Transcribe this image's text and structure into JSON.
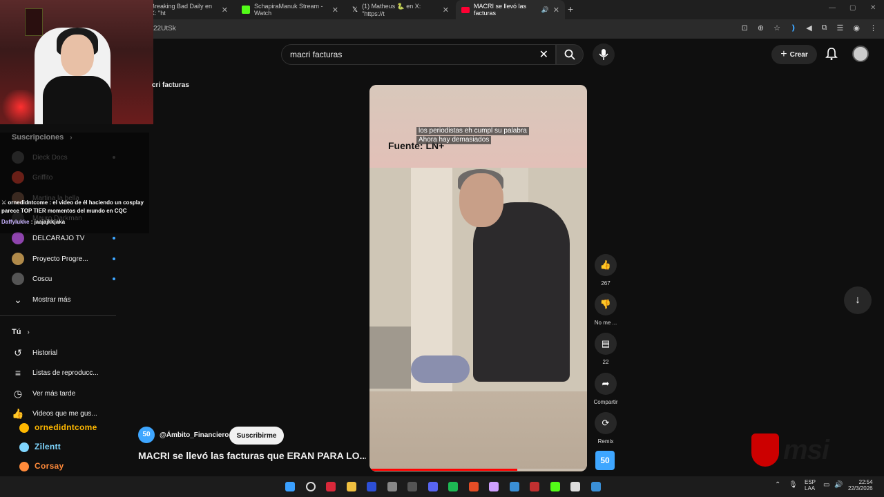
{
  "browser": {
    "tabs": [
      {
        "title": "Breaking Bad Daily en X: \"ht",
        "color": "#222222"
      },
      {
        "title": "SchapiraManuk Stream - Watch",
        "color": "#53fc18"
      },
      {
        "title": "(1) Matheus 🐍 en X: \"https://t",
        "color": "#000000"
      },
      {
        "title": "MACRI se llevó las facturas",
        "color": "#ff0033"
      }
    ],
    "url_fragment": "22UtSk"
  },
  "header": {
    "search_value": "macri facturas",
    "create_label": "Crear"
  },
  "page": {
    "partial_title": "cri facturas"
  },
  "sidebar": {
    "subscriptions_label": "Suscripciones",
    "subscriptions": [
      {
        "name": "Dieck Docs",
        "color": "#444444",
        "dim": true
      },
      {
        "name": "Griffito",
        "color": "#c0392b",
        "dim": true
      },
      {
        "name": "Martina la bella",
        "color": "#6b4c3b",
        "dim": true
      },
      {
        "name": "Mauro Darkman",
        "color": "#333333",
        "dim": true
      },
      {
        "name": "DELCARAJO TV",
        "color": "#8e44ad",
        "dim": false
      },
      {
        "name": "Proyecto Progre...",
        "color": "#b08a4a",
        "dim": false
      },
      {
        "name": "Coscu",
        "color": "#555555",
        "dim": false
      }
    ],
    "show_more": "Mostrar más",
    "you_label": "Tú",
    "you_items": [
      {
        "label": "Historial",
        "icon": "history-icon",
        "glyph": "↺"
      },
      {
        "label": "Listas de reproducc...",
        "icon": "playlist-icon",
        "glyph": "≡"
      },
      {
        "label": "Ver más tarde",
        "icon": "clock-icon",
        "glyph": "◷"
      },
      {
        "label": "Videos que me gus...",
        "icon": "thumb-up-icon",
        "glyph": "👍"
      }
    ]
  },
  "chat": [
    {
      "user": "ornedidntcome",
      "text": " : el video de él haciendo un cosplay parece TOP TIER momentos del mundo en CQC"
    },
    {
      "user": "Daffylukke",
      "text": " : jaajajkkjaka"
    }
  ],
  "alerts": [
    {
      "name": "ornedidntcome",
      "color": "#ffb800"
    },
    {
      "name": "Zilentt",
      "color": "#7fd6ff"
    },
    {
      "name": "Corsay",
      "color": "#ff8a3a"
    }
  ],
  "video": {
    "source_label": "Fuente: LN+",
    "captions": [
      "los periodistas eh cumpl su palabra",
      "Ahora hay demasiados"
    ],
    "progress": 0.68,
    "likes": "267",
    "dislike_label": "No me ...",
    "comments": "22",
    "share_label": "Compartir",
    "remix_label": "Remix",
    "channel": "@Ámbito_Financiero",
    "channel_logo_text": "50",
    "subscribe_label": "Suscribirme",
    "title": "MACRI se llevó las facturas que ERAN PARA LO..."
  },
  "brand": {
    "text": "msi",
    "color": "#cc0000"
  },
  "taskbar": {
    "lang_top": "ESP",
    "lang_bottom": "LAA",
    "time": "22:54",
    "date": "22/3/2026",
    "apps": [
      {
        "name": "windows-start-icon",
        "color": "#3aa0ff"
      },
      {
        "name": "search-icon",
        "color": "#dddddd"
      },
      {
        "name": "app-red-icon",
        "color": "#d9283a"
      },
      {
        "name": "folder-icon",
        "color": "#f0c040"
      },
      {
        "name": "v-app-icon",
        "color": "#2d4fd6"
      },
      {
        "name": "app-grey-icon",
        "color": "#888888"
      },
      {
        "name": "app-circle-icon",
        "color": "#555555"
      },
      {
        "name": "discord-icon",
        "color": "#5865f2"
      },
      {
        "name": "spotify-icon",
        "color": "#1db954"
      },
      {
        "name": "chrome-icon",
        "color": "#e44d26"
      },
      {
        "name": "app-spiral-icon",
        "color": "#cfa0ff"
      },
      {
        "name": "photos-icon",
        "color": "#3a8fd6"
      },
      {
        "name": "voicemeeter-icon",
        "color": "#c03030"
      },
      {
        "name": "kick-icon",
        "color": "#53fc18"
      },
      {
        "name": "app-c-icon",
        "color": "#dddddd"
      },
      {
        "name": "app-window-icon",
        "color": "#3a8fd6"
      }
    ]
  }
}
